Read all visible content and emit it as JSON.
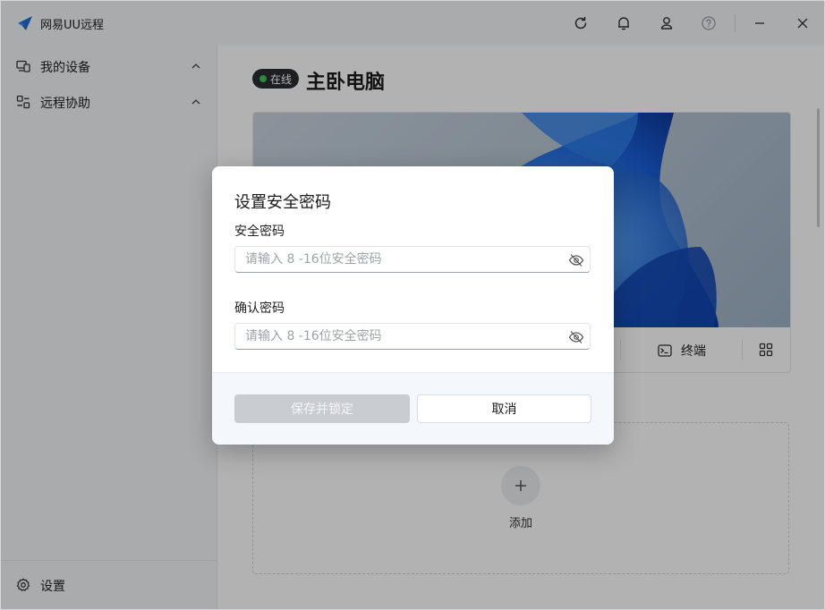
{
  "app": {
    "title": "网易UU远程"
  },
  "colors": {
    "accent": "#1f6fd6",
    "online": "#3cc35a",
    "pill_bg": "#2a2d33",
    "disabled_btn": "#c9ccd1"
  },
  "titlebar": {
    "icons": [
      "refresh-icon",
      "bell-icon",
      "user-icon",
      "help-icon",
      "minimize-icon",
      "close-icon"
    ]
  },
  "sidebar": {
    "items": [
      {
        "label": "我的设备",
        "icon": "devices-icon",
        "expanded": true
      },
      {
        "label": "远程协助",
        "icon": "assist-icon",
        "expanded": true
      }
    ],
    "footer": {
      "label": "设置",
      "icon": "gear-icon"
    }
  },
  "main": {
    "status": "在线",
    "device_name": "主卧电脑",
    "actions": {
      "terminal": "终端"
    },
    "add_label": "添加"
  },
  "dialog": {
    "title": "设置安全密码",
    "password_label": "安全密码",
    "password_placeholder": "请输入 8 -16位安全密码",
    "confirm_label": "确认密码",
    "confirm_placeholder": "请输入 8 -16位安全密码",
    "save_button": "保存并锁定",
    "cancel_button": "取消"
  }
}
